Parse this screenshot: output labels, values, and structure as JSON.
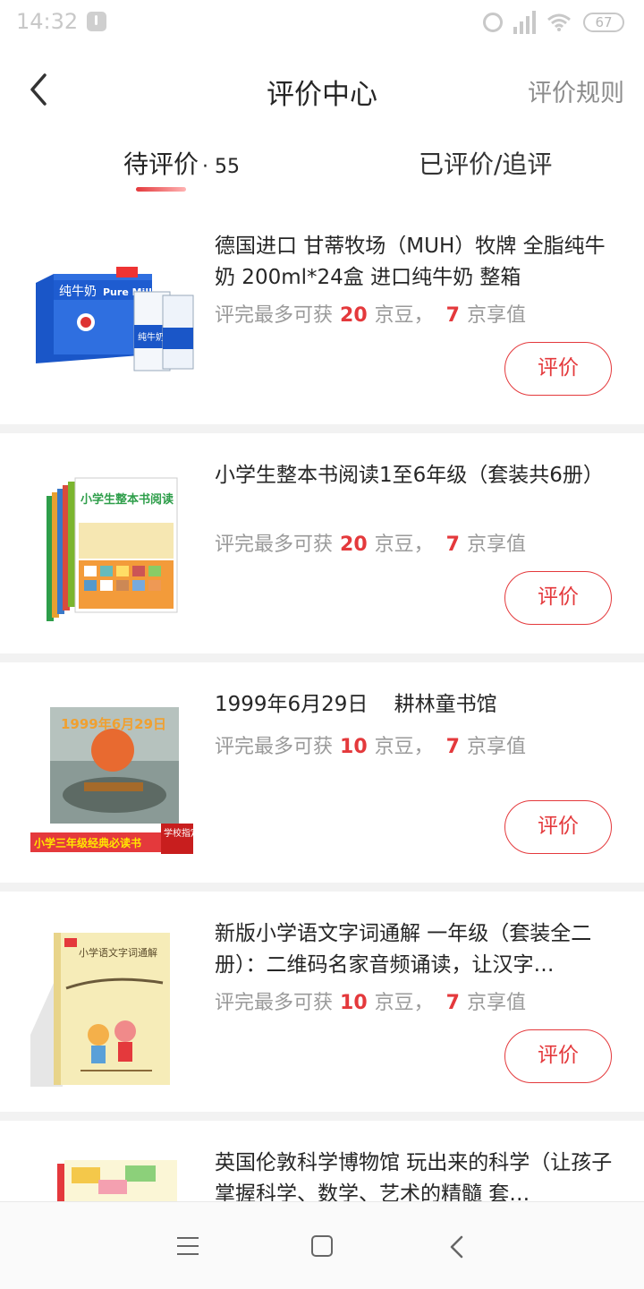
{
  "status": {
    "time": "14:32",
    "battery": "67"
  },
  "header": {
    "title": "评价中心",
    "rules_label": "评价规则"
  },
  "tabs": {
    "pending_label": "待评价",
    "pending_count": "· 55",
    "done_label": "已评价/追评"
  },
  "reward_prefix": "评完最多可获",
  "bean_unit": "京豆，",
  "value_unit": "京享值",
  "review_label": "评价",
  "products": [
    {
      "title": "德国进口 甘蒂牧场（MUH）牧牌 全脂纯牛奶 200ml*24盒 进口纯牛奶 整箱",
      "beans": "20",
      "value": "7",
      "thumb": "milk-box"
    },
    {
      "title": "小学生整本书阅读1至6年级（套装共6册）",
      "beans": "20",
      "value": "7",
      "thumb": "book-set"
    },
    {
      "title": "1999年6月29日    耕林童书馆",
      "beans": "10",
      "value": "7",
      "thumb": "picture-book",
      "thumb_banner": "小学三年级经典必读书",
      "thumb_badge": "学校指定"
    },
    {
      "title": "新版小学语文字词通解 一年级（套装全二册）：二维码名家音频诵读，让汉字…",
      "beans": "10",
      "value": "7",
      "thumb": "dictionary"
    },
    {
      "title": "英国伦敦科学博物馆 玩出来的科学（让孩子掌握科学、数学、艺术的精髓 套…",
      "beans": "",
      "value": "",
      "thumb": "science-book"
    }
  ],
  "colors": {
    "accent": "#e4393c",
    "text": "#262626",
    "muted": "#9a9a9a"
  }
}
